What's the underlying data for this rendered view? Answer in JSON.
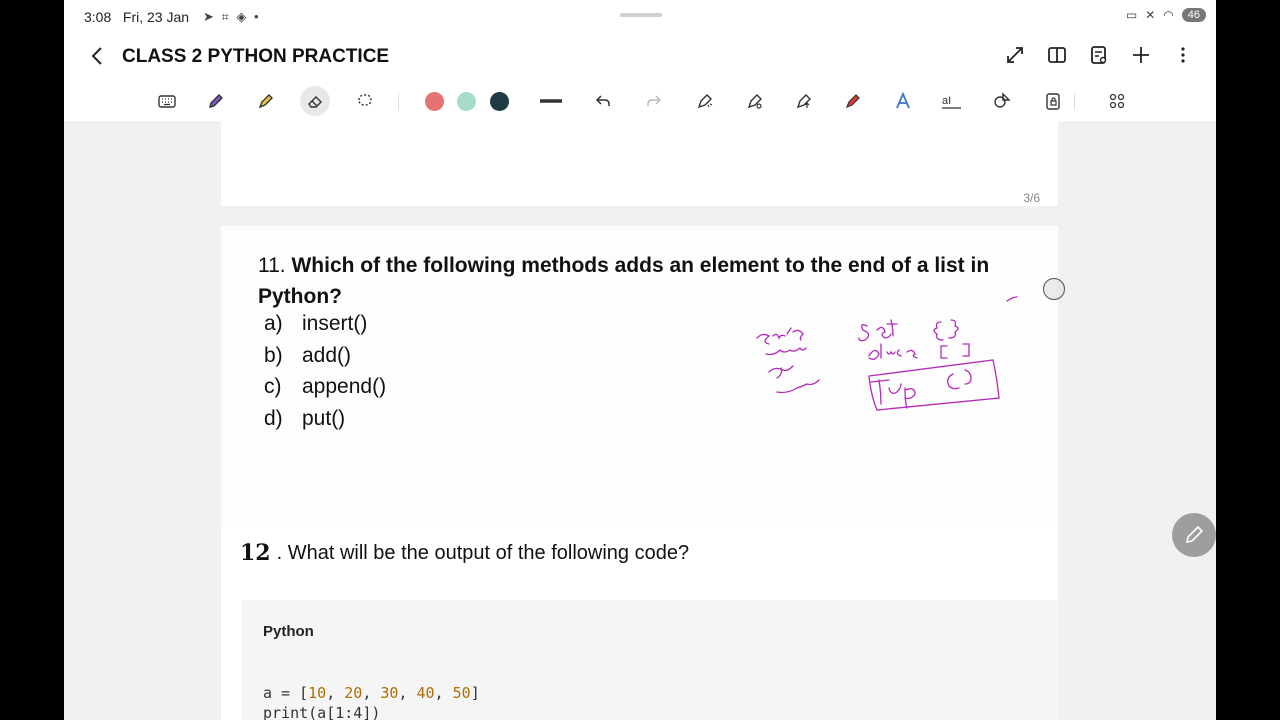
{
  "status": {
    "time": "3:08",
    "date": "Fri, 23 Jan",
    "battery": "46"
  },
  "header": {
    "title": "CLASS 2 PYTHON PRACTICE"
  },
  "toolbar": {
    "colors": [
      "#e57373",
      "#a6dcc8",
      "#1e3a44"
    ],
    "pen_color": "#b52ab8"
  },
  "pages": {
    "prev_page_number": "3/6"
  },
  "question11": {
    "number": "11.",
    "text": "Which of the following methods adds an element to the end of a list in Python?",
    "options": [
      {
        "label": "a)",
        "text": "insert()"
      },
      {
        "label": "b)",
        "text": "add()"
      },
      {
        "label": "c)",
        "text": "append()"
      },
      {
        "label": "d)",
        "text": "put()"
      }
    ]
  },
  "question12": {
    "number_handwritten": "12",
    "text": ". What will be the output of the following code?"
  },
  "code": {
    "language": "Python",
    "line1_prefix": "a = [",
    "values": [
      "10",
      "20",
      "30",
      "40",
      "50"
    ],
    "line1_suffix": "]",
    "line2": "print(a[1:4])"
  }
}
